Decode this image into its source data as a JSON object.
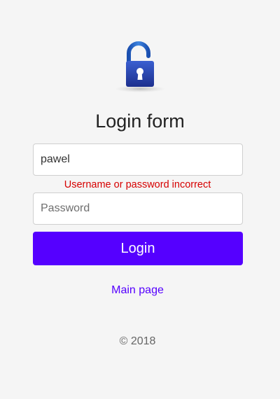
{
  "header": {
    "logo_icon": "padlock-unlocked-icon",
    "title": "Login form"
  },
  "form": {
    "username": {
      "value": "pawel",
      "placeholder": ""
    },
    "error_message": "Username or password incorrect",
    "password": {
      "value": "",
      "placeholder": "Password"
    },
    "submit_label": "Login"
  },
  "links": {
    "main_page": "Main page"
  },
  "footer": {
    "copyright": "© 2018"
  },
  "colors": {
    "accent": "#5500ff",
    "error": "#d60000",
    "background": "#f5f5f5"
  }
}
